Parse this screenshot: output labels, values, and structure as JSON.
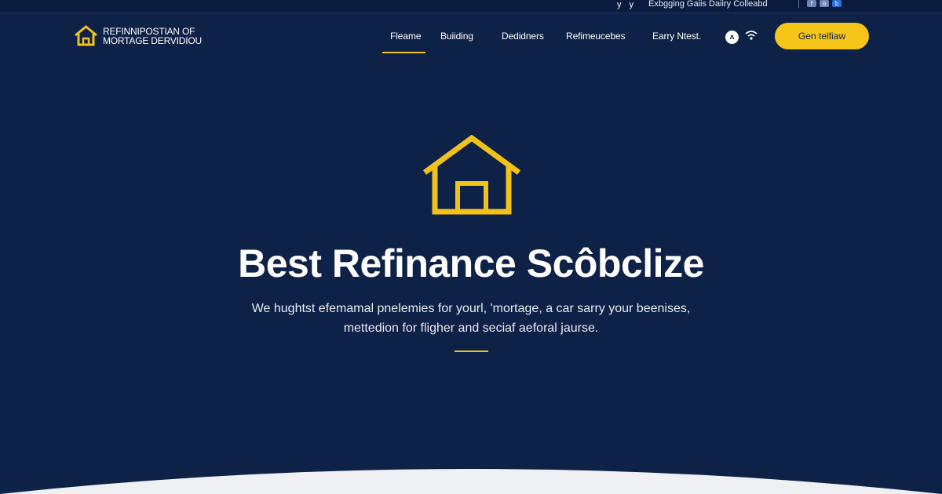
{
  "topbar": {
    "social_left": [
      "y",
      "y"
    ],
    "tagline": "Exbgging Gaiis Daiiry Colleabd",
    "social_right": [
      "f",
      "o",
      "b"
    ]
  },
  "header": {
    "logo_line1": "REFINNIPOSTIAN OF",
    "logo_line2": "MORTAGE DERVIDIOU",
    "nav": [
      "Fleame",
      "Buiiding",
      "Dedidners",
      "Refimeucebes",
      "Earry Ntest."
    ],
    "cta_label": "Gen telfiaw",
    "avatar_glyph": "ᴧ"
  },
  "hero": {
    "title": "Best Refinance Scôbclize",
    "subtitle_line1": "We hughtst efemamal pnelemies for yourl, 'mortage, a car sarry your beenises,",
    "subtitle_line2": "mettedion for fligher and seciaf aeforal jaurse."
  },
  "colors": {
    "background": "#0e2147",
    "accent": "#f5c518",
    "text": "#ffffff"
  },
  "icons": {
    "logo": "house-outline-icon",
    "hero": "house-outline-icon",
    "header": [
      "user-icon",
      "wifi-icon"
    ]
  }
}
